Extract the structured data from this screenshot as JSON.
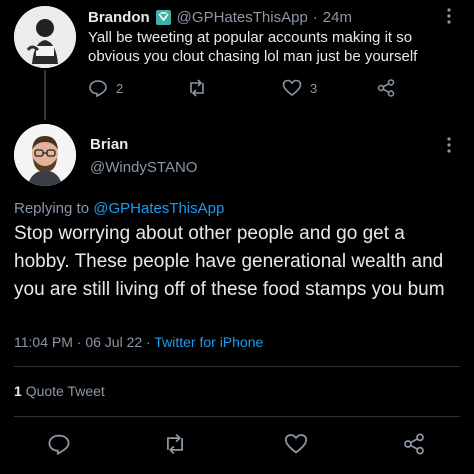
{
  "parent_tweet": {
    "display_name": "Brandon",
    "handle": "@GPHatesThisApp",
    "separator": "·",
    "time_ago": "24m",
    "text": "Yall be tweeting at popular accounts making it so obvious you clout chasing lol man just be yourself",
    "reply_count": "2",
    "like_count": "3"
  },
  "main_tweet": {
    "display_name": "Brian",
    "handle": "@WindySTANO",
    "replying_prefix": "Replying to",
    "replying_handle": "@GPHatesThisApp",
    "text": "Stop worrying about other people and go get a hobby. These people have generational wealth and you are still living off of these food stamps you bum",
    "timestamp": "11:04 PM · 06 Jul 22 · ",
    "source": "Twitter for iPhone",
    "quote_count": "1",
    "quote_label": "Quote Tweet"
  },
  "colors": {
    "background": "#000000",
    "text": "#e7e9ea",
    "muted": "#8b98a5",
    "accent": "#1d9bf0",
    "divider": "#2f3336"
  },
  "icons": [
    "avatar-brandon",
    "verified-badge-icon",
    "more-icon",
    "reply-icon",
    "retweet-icon",
    "like-icon",
    "share-icon",
    "avatar-brian"
  ]
}
